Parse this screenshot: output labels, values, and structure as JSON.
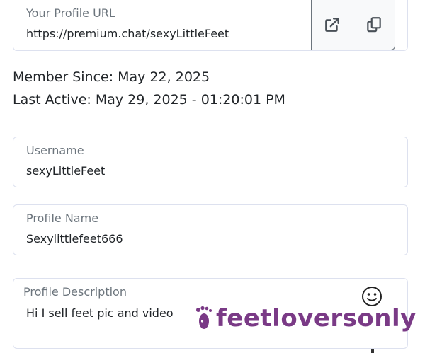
{
  "profile_url": {
    "label": "Your Profile URL",
    "value": "https://premium.chat/sexyLittleFeet"
  },
  "member_since": "Member Since: May 22, 2025",
  "last_active": "Last Active: May 29, 2025 - 01:20:01 PM",
  "username": {
    "label": "Username",
    "value": "sexyLittleFeet"
  },
  "profile_name": {
    "label": "Profile Name",
    "value": "Sexylittlefeet666"
  },
  "profile_description": {
    "label": "Profile Description",
    "value": "Hi I sell feet pic and video",
    "emoji_icon": "smiley-face-icon"
  },
  "watermark": {
    "text": "feetloversonly",
    "icon": "footprint-icon",
    "color": "#7a3a86"
  },
  "colors": {
    "border": "#dde1ef",
    "label": "#6c757d",
    "text": "#212529"
  }
}
